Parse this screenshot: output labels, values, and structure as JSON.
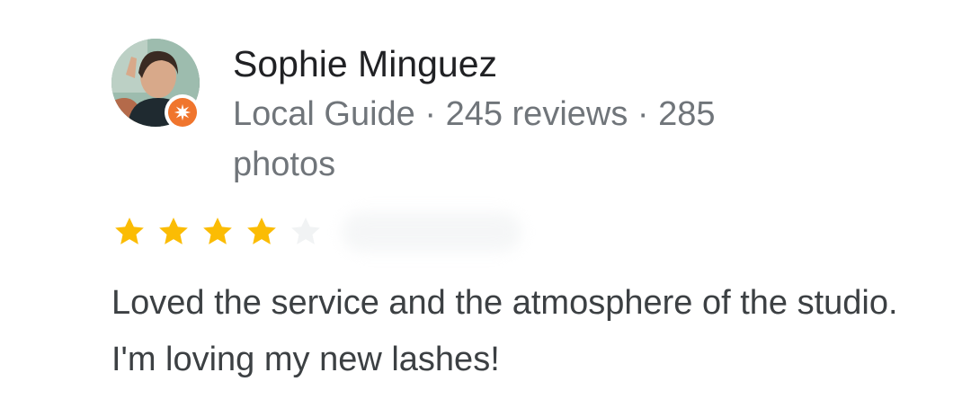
{
  "review": {
    "author": {
      "name": "Sophie Minguez",
      "meta": "Local Guide · 245 reviews · 285 photos",
      "badge_icon": "local-guide-star-icon",
      "badge_color": "#f0752d"
    },
    "rating": {
      "value": 4,
      "max": 5,
      "filled_color": "#fbbc04",
      "empty_color": "#f1f3f4"
    },
    "text": "Loved the service and the atmosphere of the studio. I'm loving my new lashes!"
  }
}
